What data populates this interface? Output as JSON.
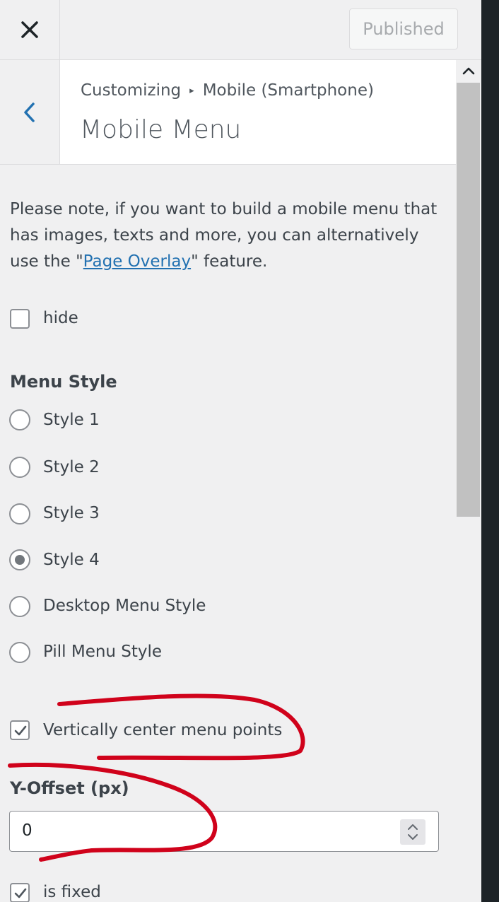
{
  "header": {
    "close_icon": "close-icon",
    "publish_label": "Published"
  },
  "section": {
    "back_icon": "chevron-left-icon",
    "breadcrumb_root": "Customizing",
    "breadcrumb_separator": "▸",
    "breadcrumb_parent": "Mobile (Smartphone)",
    "title": "Mobile Menu"
  },
  "note": {
    "before": "Please note, if you want to build a mobile menu that has images, texts and more, you can alternatively use the \"",
    "link": "Page Overlay",
    "after": "\" feature."
  },
  "hide_option": {
    "label": "hide",
    "checked": false
  },
  "menu_style": {
    "title": "Menu Style",
    "options": [
      {
        "label": "Style 1",
        "checked": false
      },
      {
        "label": "Style 2",
        "checked": false
      },
      {
        "label": "Style 3",
        "checked": false
      },
      {
        "label": "Style 4",
        "checked": true
      },
      {
        "label": "Desktop Menu Style",
        "checked": false
      },
      {
        "label": "Pill Menu Style",
        "checked": false
      }
    ]
  },
  "vertical_center": {
    "label": "Vertically center menu points",
    "checked": true
  },
  "y_offset": {
    "label": "Y-Offset (px)",
    "value": "0"
  },
  "is_fixed": {
    "label": "is fixed",
    "checked": true
  },
  "colors": {
    "link": "#2271b1",
    "annotation": "#d0021b",
    "dark_strip": "#1d2327"
  }
}
